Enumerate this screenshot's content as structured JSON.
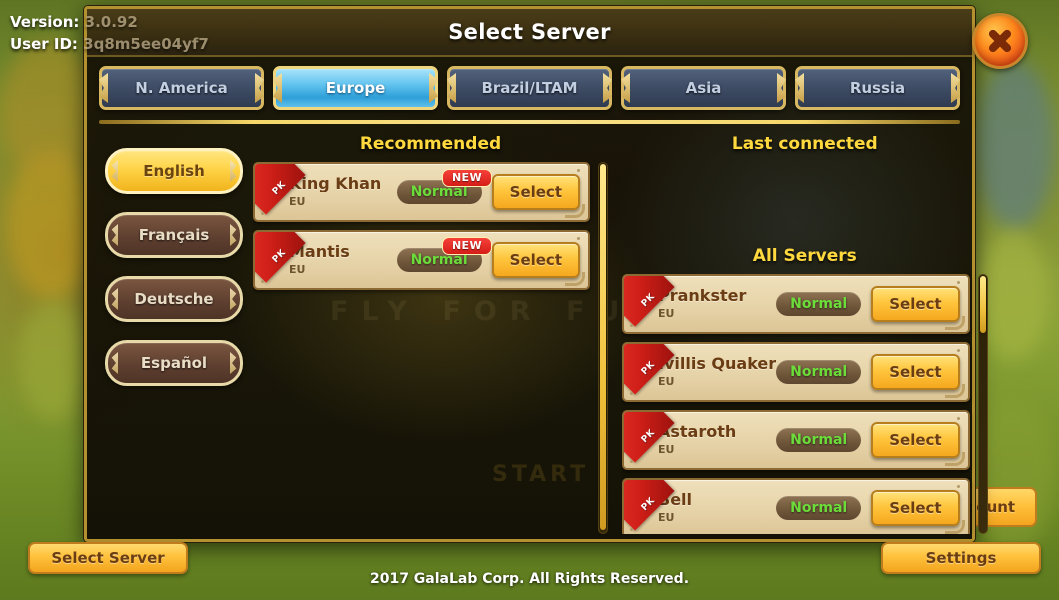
{
  "overlay": {
    "version_label": "Version:",
    "version_value": "3.0.92",
    "userid_label": "User ID:",
    "userid_value": "3q8m5ee04yf7"
  },
  "background": {
    "brand_title": "FLY FOR FUN",
    "start_label": "START",
    "account_button": "Account"
  },
  "dialog": {
    "title": "Select Server",
    "close_icon": "close-x-icon"
  },
  "region_tabs": [
    {
      "label": "N. America",
      "active": false
    },
    {
      "label": "Europe",
      "active": true
    },
    {
      "label": "Brazil/LTAM",
      "active": false
    },
    {
      "label": "Asia",
      "active": false
    },
    {
      "label": "Russia",
      "active": false
    }
  ],
  "languages": [
    {
      "label": "English",
      "active": true
    },
    {
      "label": "Français",
      "active": false
    },
    {
      "label": "Deutsche",
      "active": false
    },
    {
      "label": "Español",
      "active": false
    }
  ],
  "sections": {
    "recommended_title": "Recommended",
    "last_connected_title": "Last connected",
    "all_servers_title": "All Servers"
  },
  "labels": {
    "select": "Select",
    "new_badge": "NEW",
    "pk_ribbon": "PK"
  },
  "recommended_servers": [
    {
      "name": "King Khan",
      "region": "EU",
      "status": "Normal",
      "is_new": true,
      "pk": true,
      "select": "Select"
    },
    {
      "name": "Mantis",
      "region": "EU",
      "status": "Normal",
      "is_new": true,
      "pk": true,
      "select": "Select"
    }
  ],
  "last_connected_servers": [],
  "all_servers": [
    {
      "name": "Prankster",
      "region": "EU",
      "status": "Normal",
      "is_new": false,
      "pk": true,
      "select": "Select"
    },
    {
      "name": "Ivillis Quaker",
      "region": "EU",
      "status": "Normal",
      "is_new": false,
      "pk": true,
      "select": "Select"
    },
    {
      "name": "Astaroth",
      "region": "EU",
      "status": "Normal",
      "is_new": false,
      "pk": true,
      "select": "Select"
    },
    {
      "name": "Bell",
      "region": "EU",
      "status": "Normal",
      "is_new": false,
      "pk": true,
      "select": "Select"
    }
  ],
  "footer": {
    "select_server_button": "Select Server",
    "settings_button": "Settings",
    "copyright": "2017 GalaLab Corp. All Rights Reserved."
  },
  "colors": {
    "gold": "#f0c13c",
    "title_yellow": "#ffd93d",
    "active_tab_blue": "#63c4ef",
    "status_green": "#6cdc3a",
    "new_red": "#d41d16",
    "card_cream": "#e6d3a8"
  }
}
